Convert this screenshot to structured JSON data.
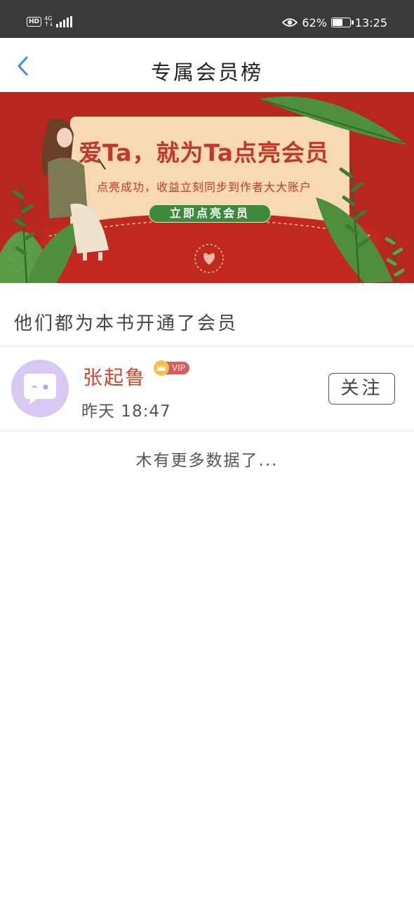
{
  "status_bar": {
    "hd": "HD",
    "network": "4G",
    "battery_percent_text": "62%",
    "battery_level": 0.62,
    "time": "13:25"
  },
  "nav": {
    "title": "专属会员榜",
    "back_icon": "chevron-left-icon",
    "accent_color": "#3b8fe6"
  },
  "banner": {
    "headline": "爱Ta，就为Ta点亮会员",
    "subtext": "点亮成功，收益立刻同步到作者大大账户",
    "button_label": "立即点亮会员",
    "colors": {
      "background": "#b8271f",
      "card": "#f7d9b4",
      "button": "#3f8a3a",
      "leaf": "#4e8f3e"
    }
  },
  "section": {
    "title": "他们都为本书开通了会员"
  },
  "members": [
    {
      "name": "张起鲁",
      "badge": "VIP",
      "time": "昨天  18:47",
      "follow_label": "关注"
    }
  ],
  "footer": {
    "no_more": "木有更多数据了..."
  }
}
